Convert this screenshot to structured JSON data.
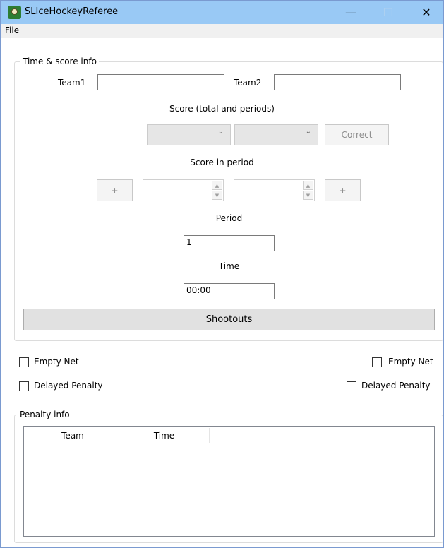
{
  "window": {
    "title": "SLIceHockeyReferee",
    "minimize_glyph": "—",
    "maximize_glyph": "☐",
    "close_glyph": "✕"
  },
  "menu": {
    "file": "File"
  },
  "time_score": {
    "group_label": "Time & score info",
    "team1_label": "Team1",
    "team2_label": "Team2",
    "team1_value": "",
    "team2_value": "",
    "score_label": "Score (total and periods)",
    "combo_arrow": "⌄",
    "correct_button": "Correct",
    "score_in_period_label": "Score in period",
    "plus_glyph": "+",
    "period_label": "Period",
    "period_value": "1",
    "time_label": "Time",
    "time_value": "00:00",
    "shootouts_button": "Shootouts"
  },
  "options": {
    "empty_net": "Empty Net",
    "delayed_penalty": "Delayed Penalty"
  },
  "penalty": {
    "group_label": "Penalty info",
    "columns": [
      "Team",
      "Time"
    ]
  }
}
